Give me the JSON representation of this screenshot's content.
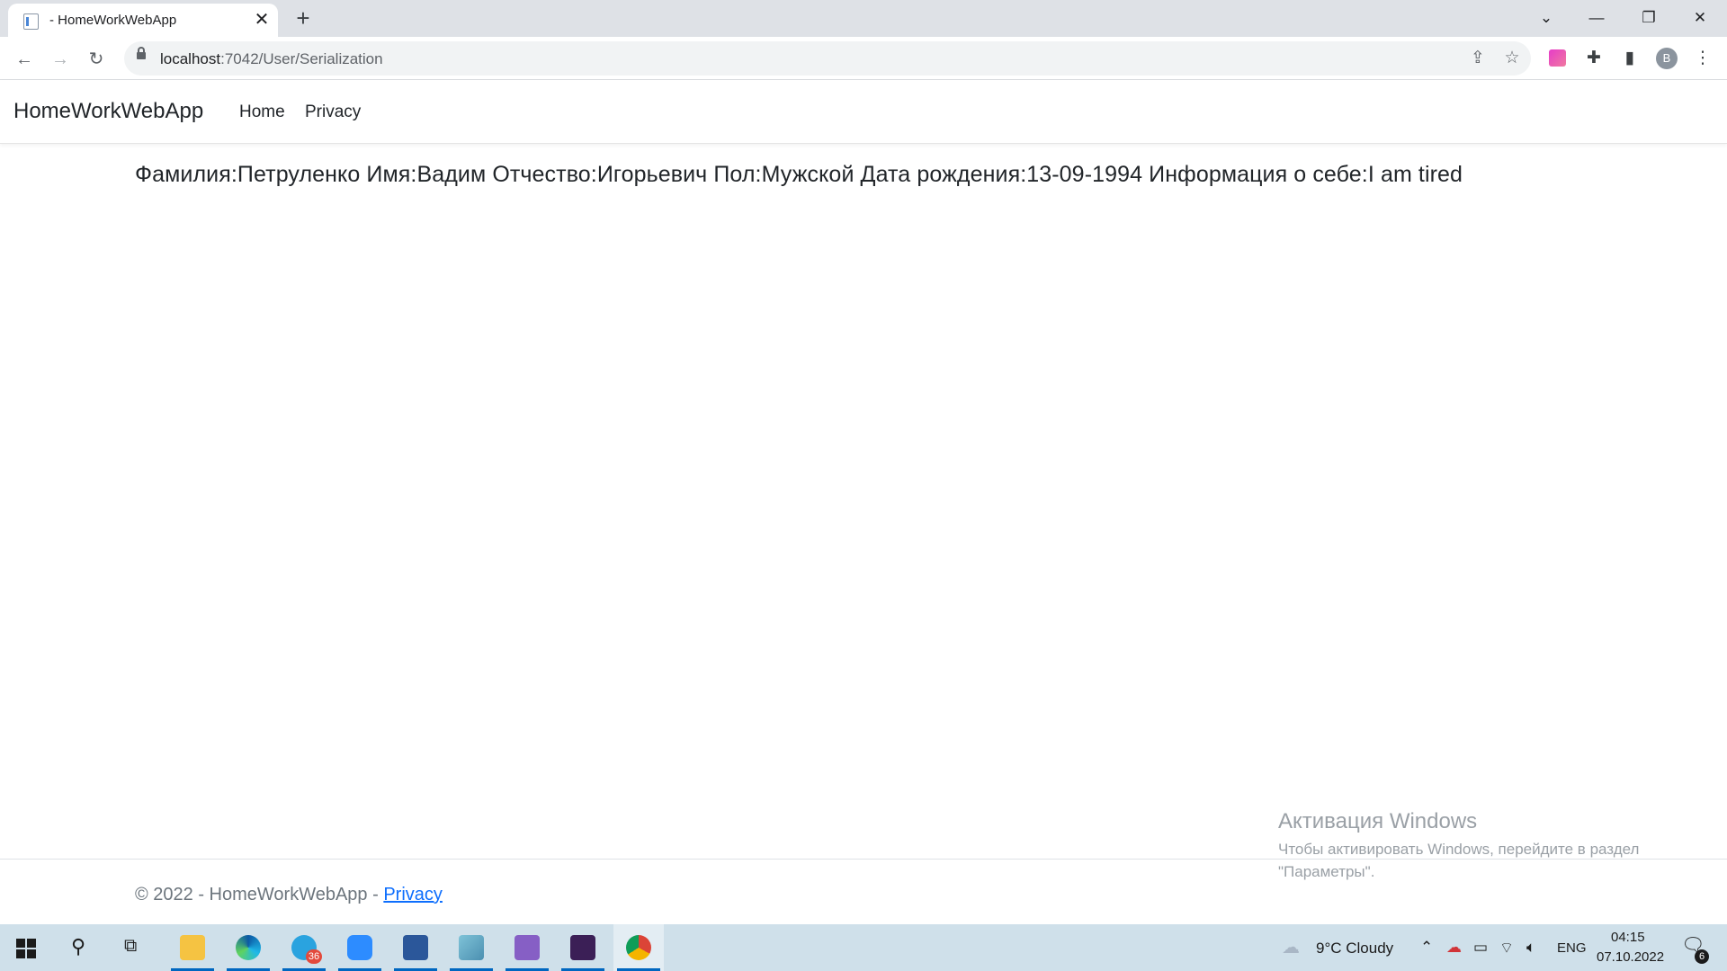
{
  "browser": {
    "tab_title": "- HomeWorkWebApp",
    "url_host": "localhost",
    "url_path": ":7042/User/Serialization",
    "avatar_letter": "B"
  },
  "site": {
    "brand": "HomeWorkWebApp",
    "nav": [
      "Home",
      "Privacy"
    ]
  },
  "content": {
    "text": "Фамилия:Петруленко Имя:Вадим Отчество:Игорьевич Пол:Мужской Дата рождения:13-09-1994 Информация о себе:I am tired"
  },
  "footer": {
    "prefix": "© 2022 - HomeWorkWebApp - ",
    "link": "Privacy"
  },
  "watermark": {
    "title": "Активация Windows",
    "line1": "Чтобы активировать Windows, перейдите в раздел",
    "line2": "\"Параметры\"."
  },
  "taskbar": {
    "weather": "9°C  Cloudy",
    "language": "ENG",
    "time": "04:15",
    "date": "07.10.2022",
    "telegram_badge": "36",
    "notifications": "6",
    "apps": [
      "file-explorer",
      "edge",
      "telegram",
      "zoom",
      "word",
      "notepad",
      "visual-studio",
      "terminal",
      "chrome"
    ]
  },
  "colors": {
    "link": "#0d6efd",
    "taskbar": "#cfe0ea",
    "accent": "#0067c0"
  }
}
